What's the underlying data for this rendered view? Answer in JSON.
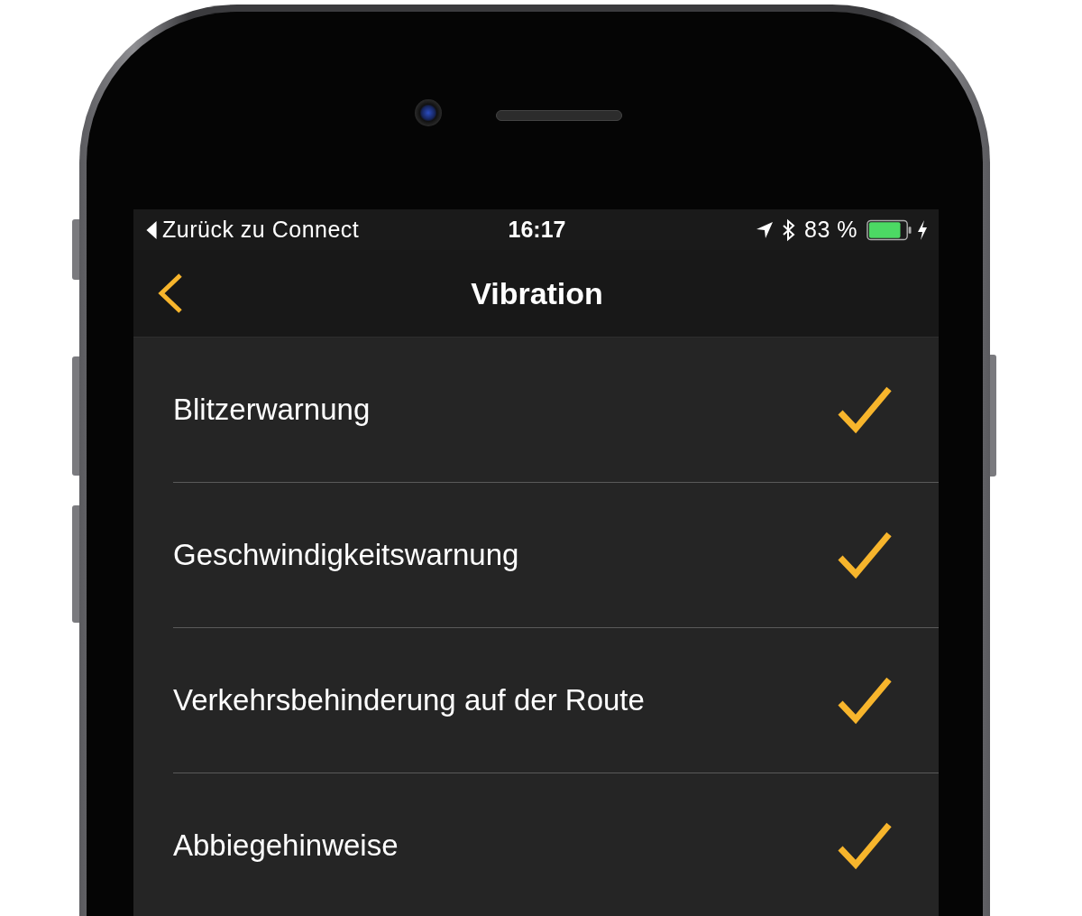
{
  "status_bar": {
    "back_label": "Zurück zu Connect",
    "time": "16:17",
    "battery": "83 %"
  },
  "nav": {
    "title": "Vibration"
  },
  "items": [
    {
      "label": "Blitzerwarnung",
      "checked": true
    },
    {
      "label": "Geschwindigkeitswarnung",
      "checked": true
    },
    {
      "label": "Verkehrsbehinderung auf der Route",
      "checked": true
    },
    {
      "label": "Abbiegehinweise",
      "checked": true
    }
  ]
}
